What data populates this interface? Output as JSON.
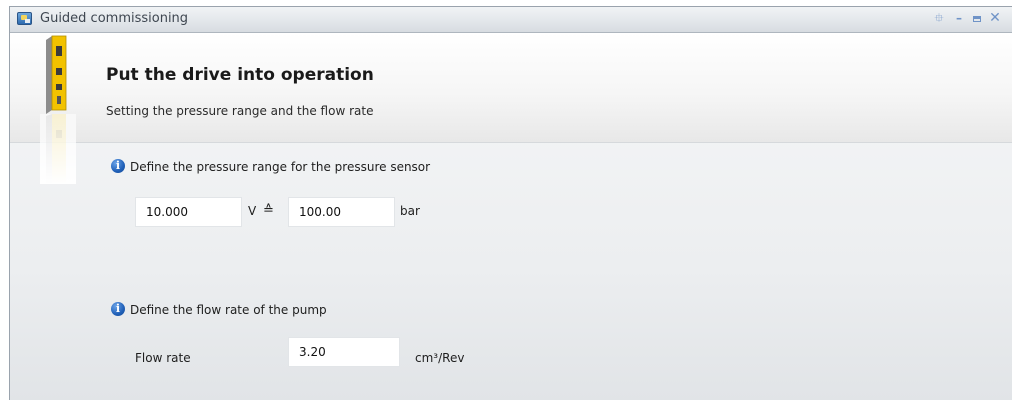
{
  "window": {
    "title": "Guided commissioning",
    "icons": [
      "app-icon",
      "pin-icon",
      "minimize-icon",
      "maximize-icon",
      "close-icon"
    ],
    "accent_color": "#6f93c7"
  },
  "header": {
    "title": "Put the drive into operation",
    "subtitle": "Setting the pressure range and the flow rate"
  },
  "pressure_section": {
    "label": "Define the pressure range for the pressure sensor",
    "voltage_value": "10.000",
    "voltage_unit": "V",
    "equivalence_symbol": "≙",
    "pressure_value": "100.00",
    "pressure_unit": "bar"
  },
  "flow_section": {
    "label": "Define the flow rate of the pump",
    "field_label": "Flow rate",
    "value": "3.20",
    "unit": "cm³/Rev"
  }
}
